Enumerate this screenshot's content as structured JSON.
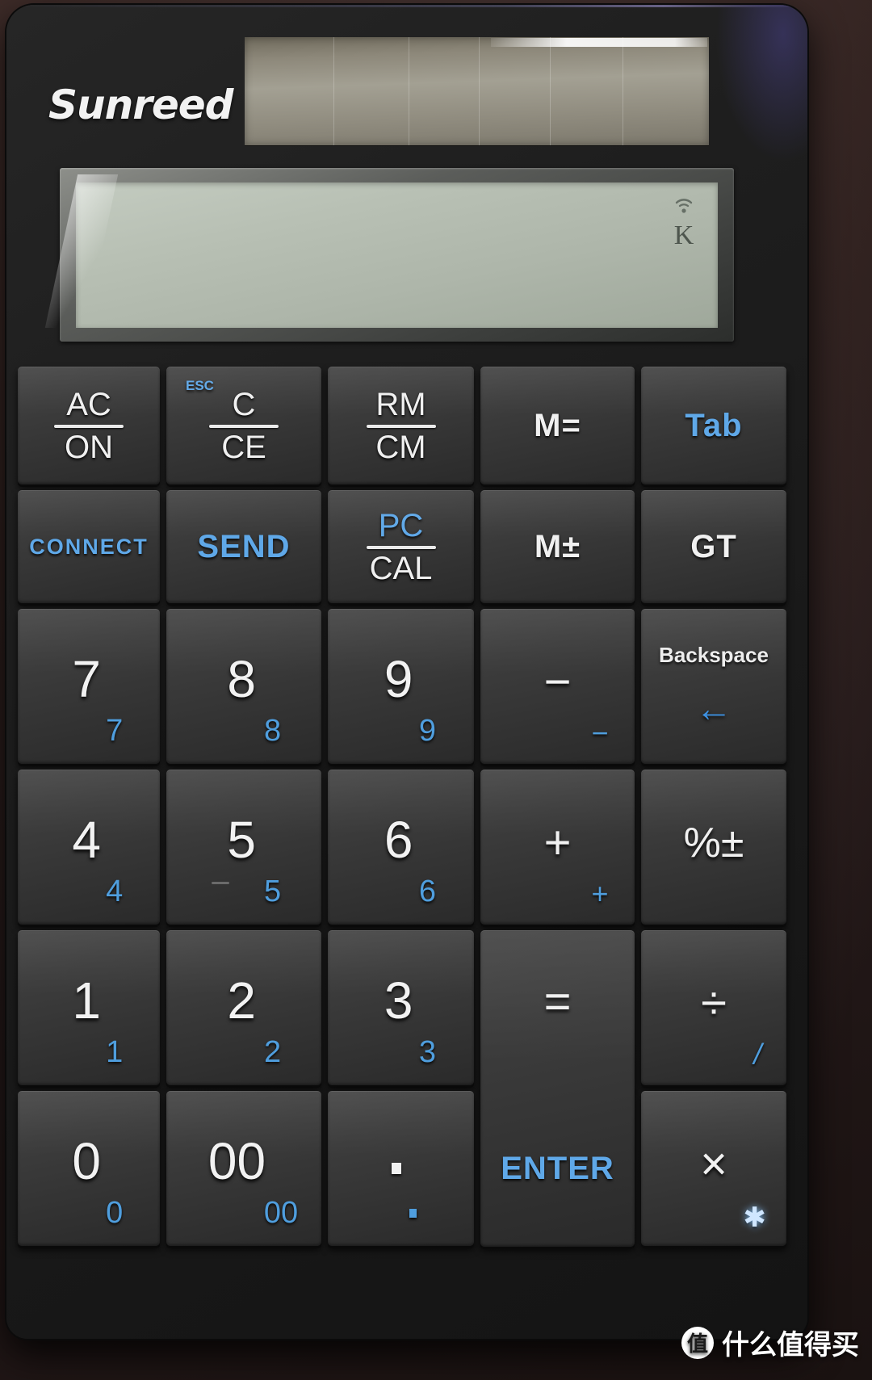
{
  "device": {
    "brand": "Sunreed",
    "type": "wireless-bluetooth-numeric-keypad-calculator"
  },
  "display": {
    "value": "",
    "indicators": {
      "wireless": "((•))",
      "memory": "K"
    }
  },
  "keypad": {
    "rows": [
      {
        "keys": [
          {
            "kind": "stack",
            "name": "key-ac-on",
            "top": "AC",
            "bottom": "ON",
            "badge": ""
          },
          {
            "kind": "stack",
            "name": "key-c-ce",
            "top": "C",
            "bottom": "CE",
            "badge": "ESC"
          },
          {
            "kind": "stack",
            "name": "key-rm-cm",
            "top": "RM",
            "bottom": "CM",
            "badge": ""
          },
          {
            "kind": "text",
            "name": "key-m-equals",
            "label": "M=",
            "color": "white",
            "size": "mid"
          },
          {
            "kind": "text",
            "name": "key-tab",
            "label": "Tab",
            "color": "blue",
            "size": "mid"
          }
        ]
      },
      {
        "keys": [
          {
            "kind": "text",
            "name": "key-connect",
            "label": "CONNECT",
            "color": "blue",
            "size": "small"
          },
          {
            "kind": "text",
            "name": "key-send",
            "label": "SEND",
            "color": "blue",
            "size": "mid"
          },
          {
            "kind": "stack",
            "name": "key-pc-cal",
            "top": "PC",
            "bottom": "CAL",
            "badge": "",
            "topColor": "blue"
          },
          {
            "kind": "text",
            "name": "key-m-plusminus",
            "label": "M±",
            "color": "white",
            "size": "mid"
          },
          {
            "kind": "text",
            "name": "key-gt",
            "label": "GT",
            "color": "white",
            "size": "mid"
          }
        ]
      },
      {
        "keys": [
          {
            "kind": "digit",
            "name": "key-7",
            "main": "7",
            "sub": "7"
          },
          {
            "kind": "digit",
            "name": "key-8",
            "main": "8",
            "sub": "8"
          },
          {
            "kind": "digit",
            "name": "key-9",
            "main": "9",
            "sub": "9"
          },
          {
            "kind": "op",
            "name": "key-minus",
            "main": "−",
            "sub": "−"
          },
          {
            "kind": "backspace",
            "name": "key-backspace",
            "label": "Backspace",
            "arrow": "←"
          }
        ]
      },
      {
        "keys": [
          {
            "kind": "digit",
            "name": "key-4",
            "main": "4",
            "sub": "4"
          },
          {
            "kind": "digit",
            "name": "key-5",
            "main": "5",
            "sub": "5",
            "homeMark": true
          },
          {
            "kind": "digit",
            "name": "key-6",
            "main": "6",
            "sub": "6"
          },
          {
            "kind": "op",
            "name": "key-plus",
            "main": "+",
            "sub": "+"
          },
          {
            "kind": "op",
            "name": "key-percent-plusminus",
            "main": "%±",
            "sub": ""
          }
        ]
      },
      {
        "keys": [
          {
            "kind": "digit",
            "name": "key-1",
            "main": "1",
            "sub": "1"
          },
          {
            "kind": "digit",
            "name": "key-2",
            "main": "2",
            "sub": "2"
          },
          {
            "kind": "digit",
            "name": "key-3",
            "main": "3",
            "sub": "3"
          },
          {
            "kind": "op",
            "name": "key-equals",
            "main": "=",
            "sub": "",
            "tall": true
          },
          {
            "kind": "op",
            "name": "key-divide",
            "main": "÷",
            "sub": "/"
          }
        ]
      },
      {
        "keys": [
          {
            "kind": "digit",
            "name": "key-0",
            "main": "0",
            "sub": "0"
          },
          {
            "kind": "digit",
            "name": "key-00",
            "main": "00",
            "sub": "00"
          },
          {
            "kind": "dot",
            "name": "key-decimal",
            "main": ".",
            "sub": "."
          },
          {
            "kind": "text",
            "name": "key-enter",
            "label": "ENTER",
            "color": "blue",
            "size": "mid"
          },
          {
            "kind": "op",
            "name": "key-multiply",
            "main": "×",
            "sub": "✱",
            "subGlow": true
          }
        ]
      }
    ]
  },
  "watermark": {
    "badge": "值",
    "text": "什么值得买"
  },
  "colors": {
    "accent_blue": "#4f9ede",
    "label_white": "#f0f0f0",
    "key_face": "#3d3d3d",
    "body": "#1e1e1e",
    "lcd": "#b8c0b4"
  }
}
